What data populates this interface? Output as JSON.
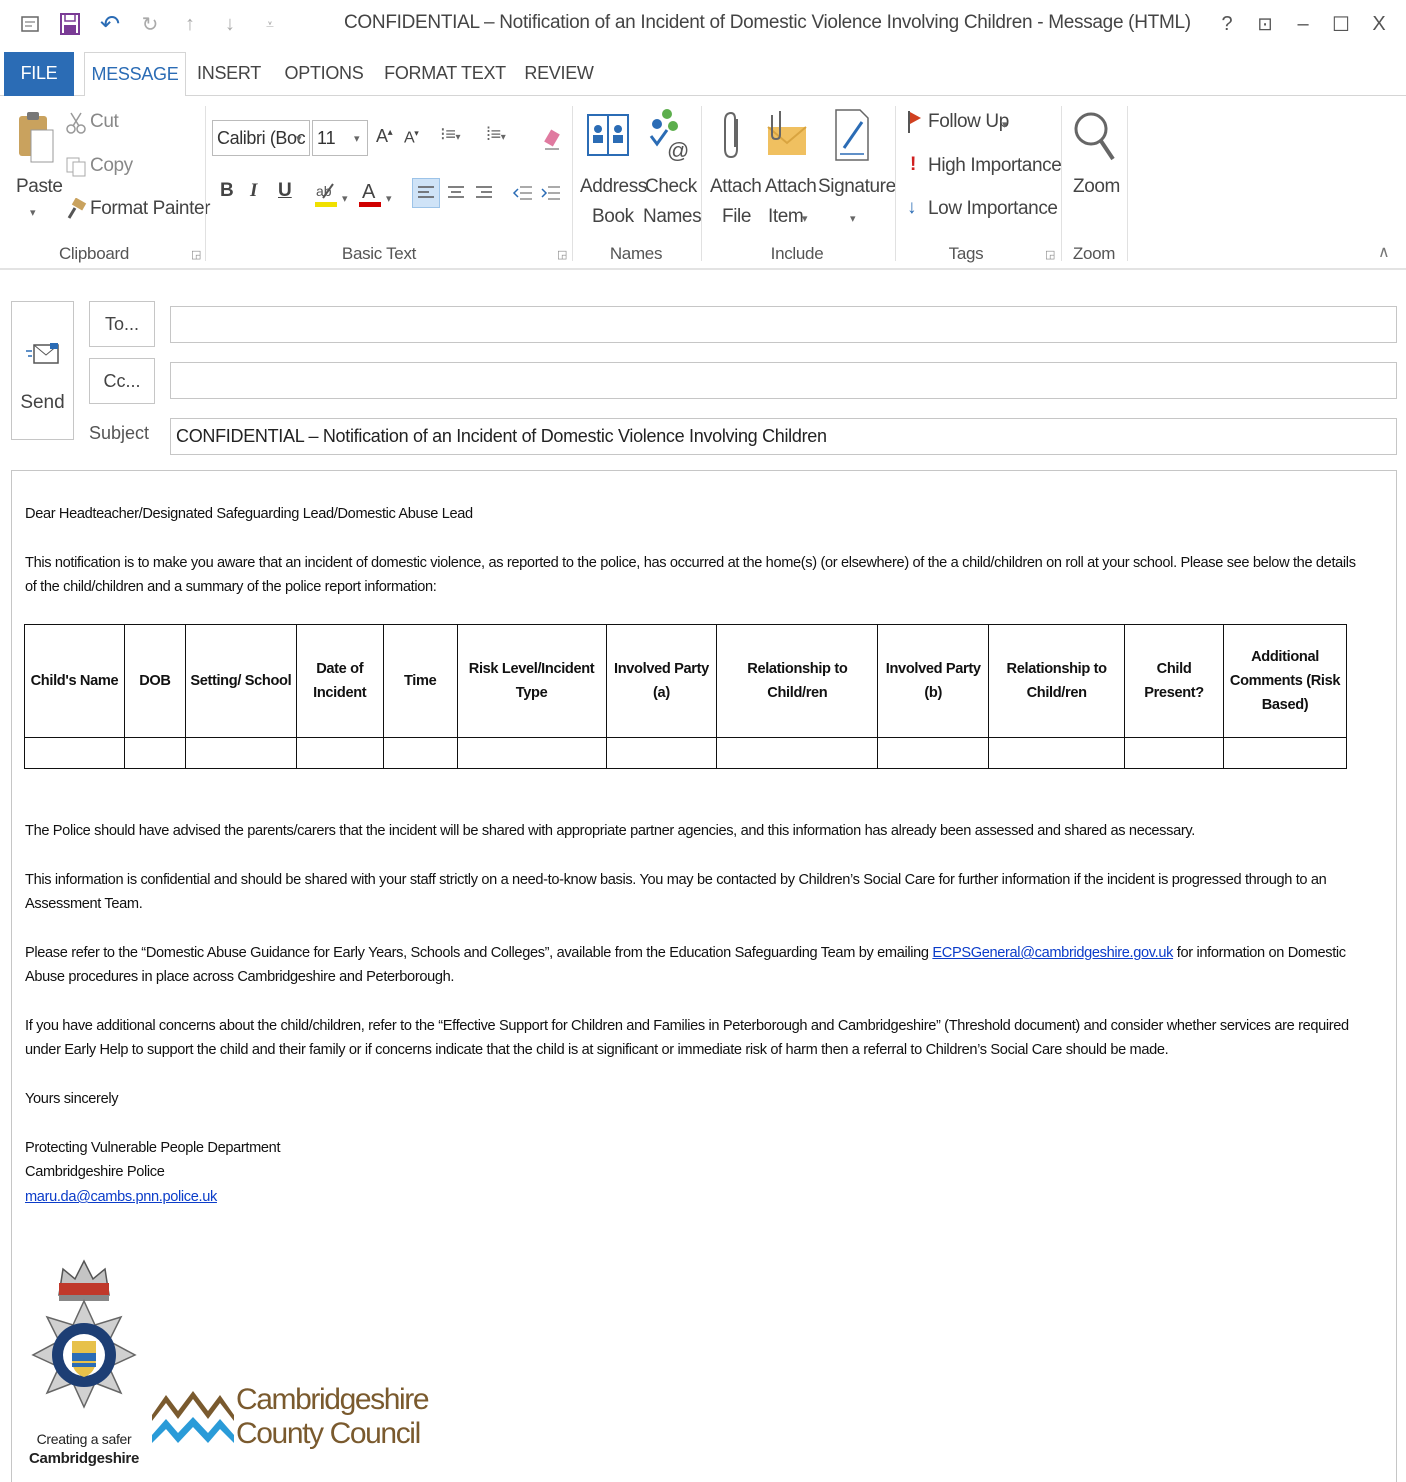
{
  "window": {
    "title": "CONFIDENTIAL – Notification of an Incident of Domestic Violence Involving Children - Message (HTML)",
    "controls": {
      "help": "?",
      "restore": "⊡",
      "minimize": "–",
      "maximize": "☐",
      "close": "X"
    }
  },
  "ribbon_tabs": [
    "FILE",
    "MESSAGE",
    "INSERT",
    "OPTIONS",
    "FORMAT TEXT",
    "REVIEW"
  ],
  "ribbon": {
    "clipboard": {
      "label": "Clipboard",
      "paste": "Paste",
      "cut": "Cut",
      "copy": "Copy",
      "format_painter": "Format Painter"
    },
    "basic_text": {
      "label": "Basic Text",
      "font": "Calibri (Boc",
      "size": "11",
      "bold": "B",
      "italic": "I",
      "underline": "U"
    },
    "names": {
      "label": "Names",
      "address_book": [
        "Address",
        "Book"
      ],
      "check_names": [
        "Check",
        "Names"
      ]
    },
    "include": {
      "label": "Include",
      "attach_file": [
        "Attach",
        "File"
      ],
      "attach_item": [
        "Attach",
        "Item"
      ],
      "signature": "Signature"
    },
    "tags": {
      "label": "Tags",
      "follow_up": "Follow Up",
      "high": "High Importance",
      "low": "Low Importance"
    },
    "zoom": {
      "label": "Zoom",
      "button": "Zoom"
    }
  },
  "compose": {
    "send": "Send",
    "to_button": "To...",
    "cc_button": "Cc...",
    "to_value": "",
    "cc_value": "",
    "subject_label": "Subject",
    "subject_value": "CONFIDENTIAL – Notification of an Incident of Domestic Violence Involving Children"
  },
  "message": {
    "greeting": "Dear Headteacher/Designated Safeguarding Lead/Domestic Abuse Lead",
    "para1": "This notification is to make you aware that an incident of domestic violence, as reported to the police, has occurred at the home(s) (or elsewhere) of the a child/children on roll at your school.  Please see below the details of the child/children and a summary of the police report information:",
    "table_headers": [
      "Child's Name",
      "DOB",
      "Setting/ School",
      "Date of Incident",
      "Time",
      "Risk Level/Incident Type",
      "Involved Party (a)",
      "Relationship to Child/ren",
      "Involved Party (b)",
      "Relationship to Child/ren",
      "Child Present?",
      "Additional Comments (Risk Based)"
    ],
    "para2": "The Police should have advised the parents/carers that the incident will be shared with appropriate partner agencies, and this information has already been assessed and shared as necessary.",
    "para3": "This information is confidential and should be shared with your staff strictly on a need-to-know basis.  You may be contacted by Children’s Social Care for further information if the incident is progressed through to an Assessment Team.",
    "para4_before": "Please refer to the “Domestic Abuse Guidance for Early Years, Schools and Colleges”, available from the Education Safeguarding Team by emailing ",
    "para4_link": "ECPSGeneral@cambridgeshire.gov.uk",
    "para4_after": " for information on Domestic Abuse procedures in place across Cambridgeshire and Peterborough.",
    "para5": "If you have additional concerns about the child/children, refer to the “Effective Support for Children and Families in Peterborough and Cambridgeshire” (Threshold document) and consider whether services are required under Early Help to support the child and their family or if concerns indicate that the child is at significant or immediate risk of harm then a referral to Children’s Social Care should be made.",
    "closing": "Yours sincerely",
    "sig_line1": "Protecting Vulnerable People Department",
    "sig_line2": "Cambridgeshire Police",
    "sig_email": "maru.da@cambs.pnn.police.uk"
  },
  "logos": {
    "police_caption_line1": "Creating a safer",
    "police_caption_line2": "Cambridgeshire",
    "council_line1": "Cambridgeshire",
    "council_line2": "County Council"
  }
}
